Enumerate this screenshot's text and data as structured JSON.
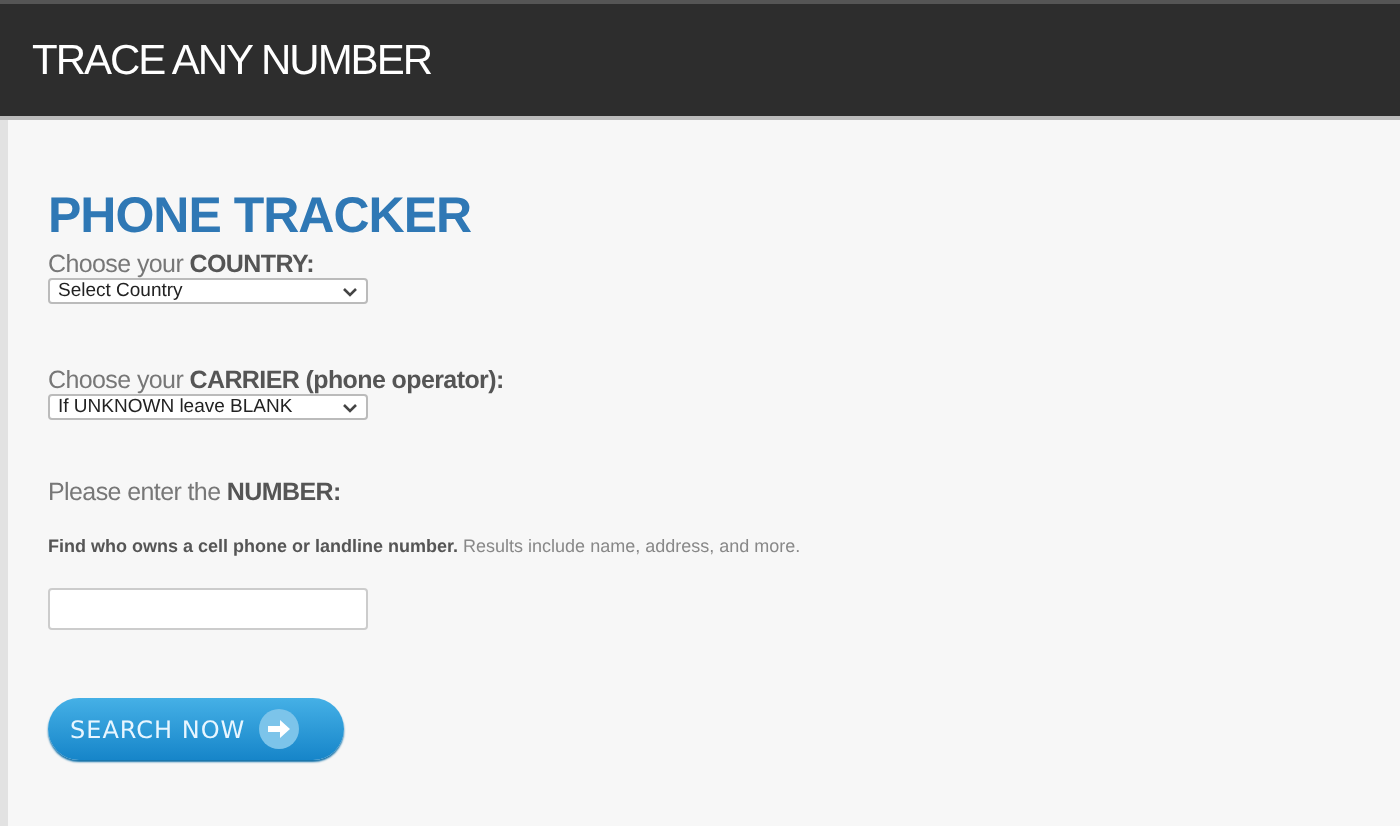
{
  "header": {
    "title": "TRACE ANY NUMBER"
  },
  "form": {
    "heading": "PHONE TRACKER",
    "country": {
      "label": "Choose your **COUNTRY:**",
      "value": "Select Country"
    },
    "carrier": {
      "label": "Choose your **CARRIER (phone operator):**",
      "value": "If UNKNOWN leave BLANK"
    },
    "number": {
      "label": "Please enter the **NUMBER:**",
      "description": "**Find who owns a cell phone or landline number.** Results include name, address, and more."
    },
    "button": "SEARCH NOW"
  }
}
